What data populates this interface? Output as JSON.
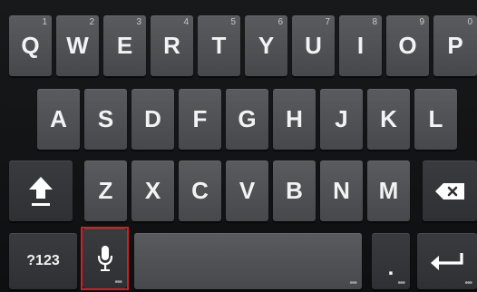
{
  "keyboard": {
    "row1": [
      {
        "label": "Q",
        "hint": "1"
      },
      {
        "label": "W",
        "hint": "2"
      },
      {
        "label": "E",
        "hint": "3"
      },
      {
        "label": "R",
        "hint": "4"
      },
      {
        "label": "T",
        "hint": "5"
      },
      {
        "label": "Y",
        "hint": "6"
      },
      {
        "label": "U",
        "hint": "7"
      },
      {
        "label": "I",
        "hint": "8"
      },
      {
        "label": "O",
        "hint": "9"
      },
      {
        "label": "P",
        "hint": "0"
      }
    ],
    "row2": [
      "A",
      "S",
      "D",
      "F",
      "G",
      "H",
      "J",
      "K",
      "L"
    ],
    "row3": [
      "Z",
      "X",
      "C",
      "V",
      "B",
      "N",
      "M"
    ],
    "bottom": {
      "symbols_label": "?123",
      "period_label": ".",
      "mic_icon": "microphone-icon",
      "shift_icon": "shift-icon",
      "backspace_icon": "backspace-icon",
      "enter_icon": "enter-icon"
    },
    "colors": {
      "background": "#111214",
      "key": "#505154",
      "key_text": "#f3f3f3",
      "highlight": "#d02025"
    }
  }
}
